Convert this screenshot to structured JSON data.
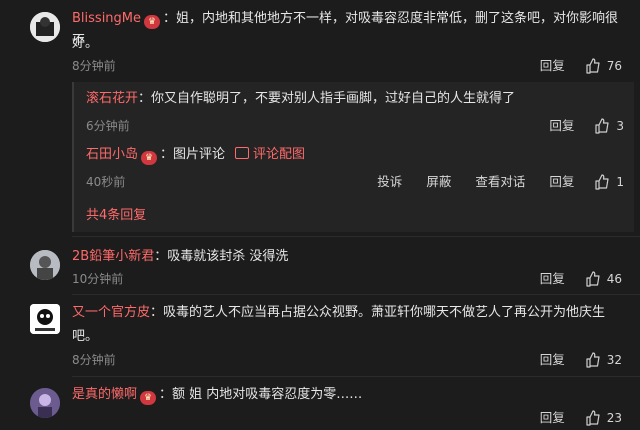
{
  "comments": [
    {
      "name": "BlissingMe",
      "text_line1": "：姐，内地和其他地方不一样，对吸毒容忍度非常低，删了这条吧，对你影响很不",
      "text_line2": "好。",
      "time": "8分钟前",
      "reply": "回复",
      "likes": "76"
    },
    {
      "name": "2B鉛筆小新君",
      "text_line1": "：吸毒就该封杀 没得洗",
      "time": "10分钟前",
      "reply": "回复",
      "likes": "46"
    },
    {
      "name": "又一个官方皮",
      "text_line1": "：吸毒的艺人不应当再占据公众视野。萧亚轩你哪天不做艺人了再公开为他庆生",
      "text_line2": "吧。",
      "time": "8分钟前",
      "reply": "回复",
      "likes": "32"
    },
    {
      "name": "是真的懒啊",
      "text_line1": "：额 姐 内地对吸毒容忍度为零……",
      "reply": "回复",
      "likes": "23"
    }
  ],
  "replies": [
    {
      "name": "滚石花开",
      "text": "：你又自作聪明了，不要对别人指手画脚，过好自己的人生就得了",
      "time": "6分钟前",
      "reply": "回复",
      "likes": "3"
    },
    {
      "name": "石田小岛",
      "text": "：图片评论",
      "pic_label": "评论配图",
      "time": "40秒前",
      "report": "投诉",
      "block": "屏蔽",
      "view_conv": "查看对话",
      "reply": "回复",
      "likes": "1"
    }
  ],
  "more_replies": "共4条回复",
  "colors": {
    "name": "#ff6a6a",
    "bg": "#1c1c1c",
    "reply_bg": "#242424"
  }
}
